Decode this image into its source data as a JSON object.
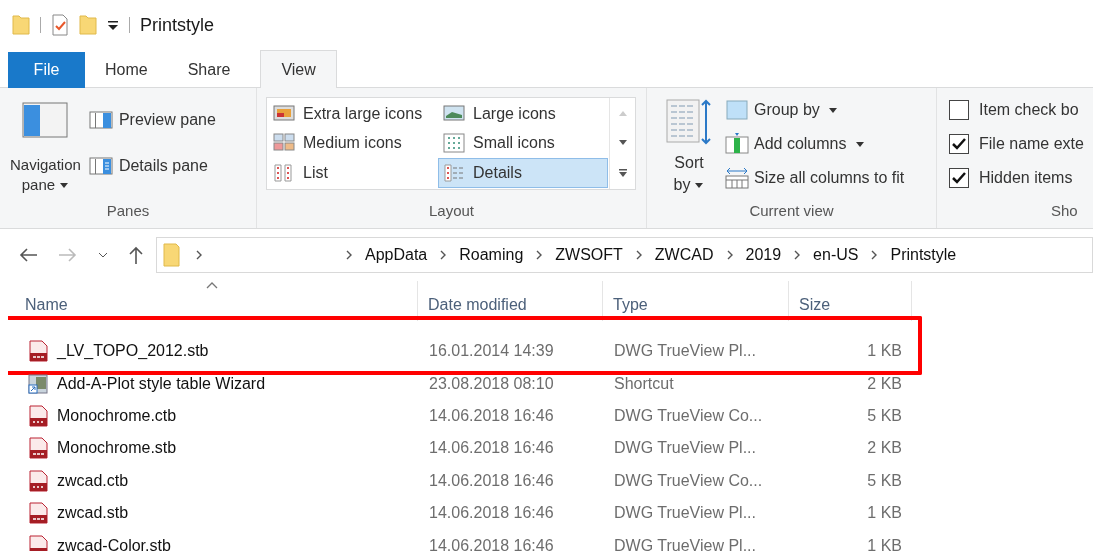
{
  "window": {
    "title": "Printstyle"
  },
  "tabs": [
    {
      "label": "File",
      "kind": "file",
      "selected": false
    },
    {
      "label": "Home",
      "kind": "tab",
      "selected": false
    },
    {
      "label": "Share",
      "kind": "tab",
      "selected": false
    },
    {
      "label": "View",
      "kind": "tab",
      "selected": true
    }
  ],
  "panes": {
    "label": "Panes",
    "navigation_pane": [
      "Navigation",
      "pane"
    ],
    "items": [
      "Preview pane",
      "Details pane"
    ]
  },
  "layout": {
    "label": "Layout",
    "items": [
      {
        "label": "Extra large icons",
        "selected": false
      },
      {
        "label": "Large icons",
        "selected": false
      },
      {
        "label": "Medium icons",
        "selected": false
      },
      {
        "label": "Small icons",
        "selected": false
      },
      {
        "label": "List",
        "selected": false
      },
      {
        "label": "Details",
        "selected": true
      }
    ]
  },
  "current_view": {
    "label": "Current view",
    "sort_by": [
      "Sort",
      "by"
    ],
    "items": [
      {
        "label": "Group by",
        "dropdown": true
      },
      {
        "label": "Add columns",
        "dropdown": true
      },
      {
        "label": "Size all columns to fit",
        "dropdown": false
      }
    ]
  },
  "show_hide": {
    "label": "Sho",
    "items": [
      {
        "label": "Item check bo",
        "checked": false
      },
      {
        "label": "File name exte",
        "checked": true
      },
      {
        "label": "Hidden items",
        "checked": true
      }
    ]
  },
  "address": {
    "segments": [
      "AppData",
      "Roaming",
      "ZWSOFT",
      "ZWCAD",
      "2019",
      "en-US",
      "Printstyle"
    ]
  },
  "table": {
    "columns": [
      {
        "label": "Name",
        "sorted": true
      },
      {
        "label": "Date modified",
        "sorted": false
      },
      {
        "label": "Type",
        "sorted": false
      },
      {
        "label": "Size",
        "sorted": false
      }
    ],
    "rows": [
      {
        "name": "_LV_TOPO_2012.stb",
        "kind": "stb",
        "date": "16.01.2014 14:39",
        "type": "DWG TrueView Pl...",
        "size": "1 KB",
        "highlighted": true
      },
      {
        "name": "Add-A-Plot style table Wizard",
        "kind": "shortcut",
        "date": "23.08.2018 08:10",
        "type": "Shortcut",
        "size": "2 KB",
        "highlighted": false
      },
      {
        "name": "Monochrome.ctb",
        "kind": "ctb",
        "date": "14.06.2018 16:46",
        "type": "DWG TrueView Co...",
        "size": "5 KB",
        "highlighted": false
      },
      {
        "name": "Monochrome.stb",
        "kind": "stb",
        "date": "14.06.2018 16:46",
        "type": "DWG TrueView Pl...",
        "size": "2 KB",
        "highlighted": false
      },
      {
        "name": "zwcad.ctb",
        "kind": "ctb",
        "date": "14.06.2018 16:46",
        "type": "DWG TrueView Co...",
        "size": "5 KB",
        "highlighted": false
      },
      {
        "name": "zwcad.stb",
        "kind": "stb",
        "date": "14.06.2018 16:46",
        "type": "DWG TrueView Pl...",
        "size": "1 KB",
        "highlighted": false
      },
      {
        "name": "zwcad-Color.stb",
        "kind": "stb",
        "date": "14.06.2018 16:46",
        "type": "DWG TrueView Pl...",
        "size": "1 KB",
        "highlighted": false
      }
    ]
  }
}
